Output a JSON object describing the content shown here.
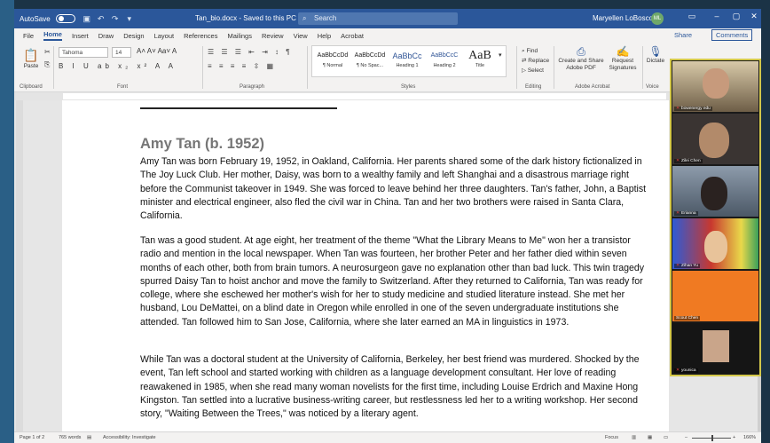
{
  "titlebar": {
    "autosave_label": "AutoSave",
    "autosave_state": "Off",
    "document_title": "Tan_bio.docx - Saved to this PC",
    "search_placeholder": "Search",
    "user_name": "Maryellen LoBosco",
    "user_initials": "ML"
  },
  "menu": {
    "tabs": [
      "File",
      "Home",
      "Insert",
      "Draw",
      "Design",
      "Layout",
      "References",
      "Mailings",
      "Review",
      "View",
      "Help",
      "Acrobat"
    ],
    "share": "Share",
    "comments": "Comments"
  },
  "ribbon": {
    "paste_label": "Paste",
    "font_name": "Tahoma",
    "font_size": "14",
    "font_format_glyphs": "B I U ab x₂ x² A A",
    "paragraph_glyphs_1": "☰ ☰ ☰ ⇤ ⇥ ↕ ¶",
    "paragraph_glyphs_2": "≡ ≡ ≡ ≡ ⇳ ▦",
    "styles": [
      {
        "preview": "AaBbCcDd",
        "label": "¶ Normal"
      },
      {
        "preview": "AaBbCcDd",
        "label": "¶ No Spac..."
      },
      {
        "preview": "AaBbCc",
        "label": "Heading 1"
      },
      {
        "preview": "AaBbCcC",
        "label": "Heading 2"
      },
      {
        "preview": "AaB",
        "label": "Title"
      }
    ],
    "editing": {
      "find": "Find",
      "replace": "Replace",
      "select": "Select"
    },
    "acrobat_create": "Create and Share Adobe PDF",
    "acrobat_request": "Request Signatures",
    "dictate": "Dictate",
    "groups": {
      "clipboard": "Clipboard",
      "font": "Font",
      "paragraph": "Paragraph",
      "styles": "Styles",
      "editing": "Editing",
      "adobe": "Adobe Acrobat",
      "voice": "Voice"
    }
  },
  "document": {
    "heading": "Amy Tan (b. 1952)",
    "p1": "Amy Tan was born February 19, 1952, in Oakland, California. Her parents shared some of the dark history fictionalized in The Joy Luck Club. Her mother, Daisy, was born to a wealthy family and left Shanghai and a disastrous marriage right before the Communist takeover in 1949. She was forced to leave behind her three daughters. Tan's father, John, a Baptist minister and electrical engineer, also fled the civil war in China. Tan and her two brothers were raised in Santa Clara, California.",
    "p2": "Tan was a good student. At age eight, her treatment of the theme \"What the Library Means to Me\" won her a transistor radio and mention in the local newspaper. When Tan was fourteen, her brother Peter and her father died within seven months of each other, both from brain tumors. A neurosurgeon gave no explanation other than bad luck. This twin tragedy spurred Daisy Tan to hoist anchor and move the family to Switzerland. After they returned to California, Tan was ready for college, where she eschewed her mother's wish for her to study medicine and studied literature instead. She met her husband, Lou DeMattei, on a blind date in Oregon while enrolled in one of the seven undergraduate institutions she attended. Tan followed him to San Jose, California, where she later earned an MA in linguistics in 1973.",
    "p3": "While Tan was a doctoral student at the University of California, Berkeley, her best friend was murdered. Shocked by the event, Tan left school and started working with children as a language development consultant. Her love of reading reawakened in 1985, when she read many woman novelists for the first time, including Louise Erdrich and Maxine Hong Kingston. Tan settled into a lucrative business-writing career, but restlessness led her to a writing workshop. Her second story, \"Waiting Between the Trees,\" was noticed by a literary agent."
  },
  "status": {
    "page": "Page 1 of 2",
    "words": "765 words",
    "accessibility": "Accessibility: Investigate",
    "focus": "Focus",
    "zoom": "166%"
  },
  "gallery": [
    {
      "name": "bowenergy edu",
      "bg": "#8a7a5e"
    },
    {
      "name": "Zilei Chen",
      "bg": "#3a3432"
    },
    {
      "name": "Erianna",
      "bg": "#5d6a7a"
    },
    {
      "name": "Zihan Yu",
      "bg": "#c8382e"
    },
    {
      "name": "Scout Chen",
      "bg": "#f07a22"
    },
    {
      "name": "younica",
      "bg": "#151515"
    }
  ]
}
